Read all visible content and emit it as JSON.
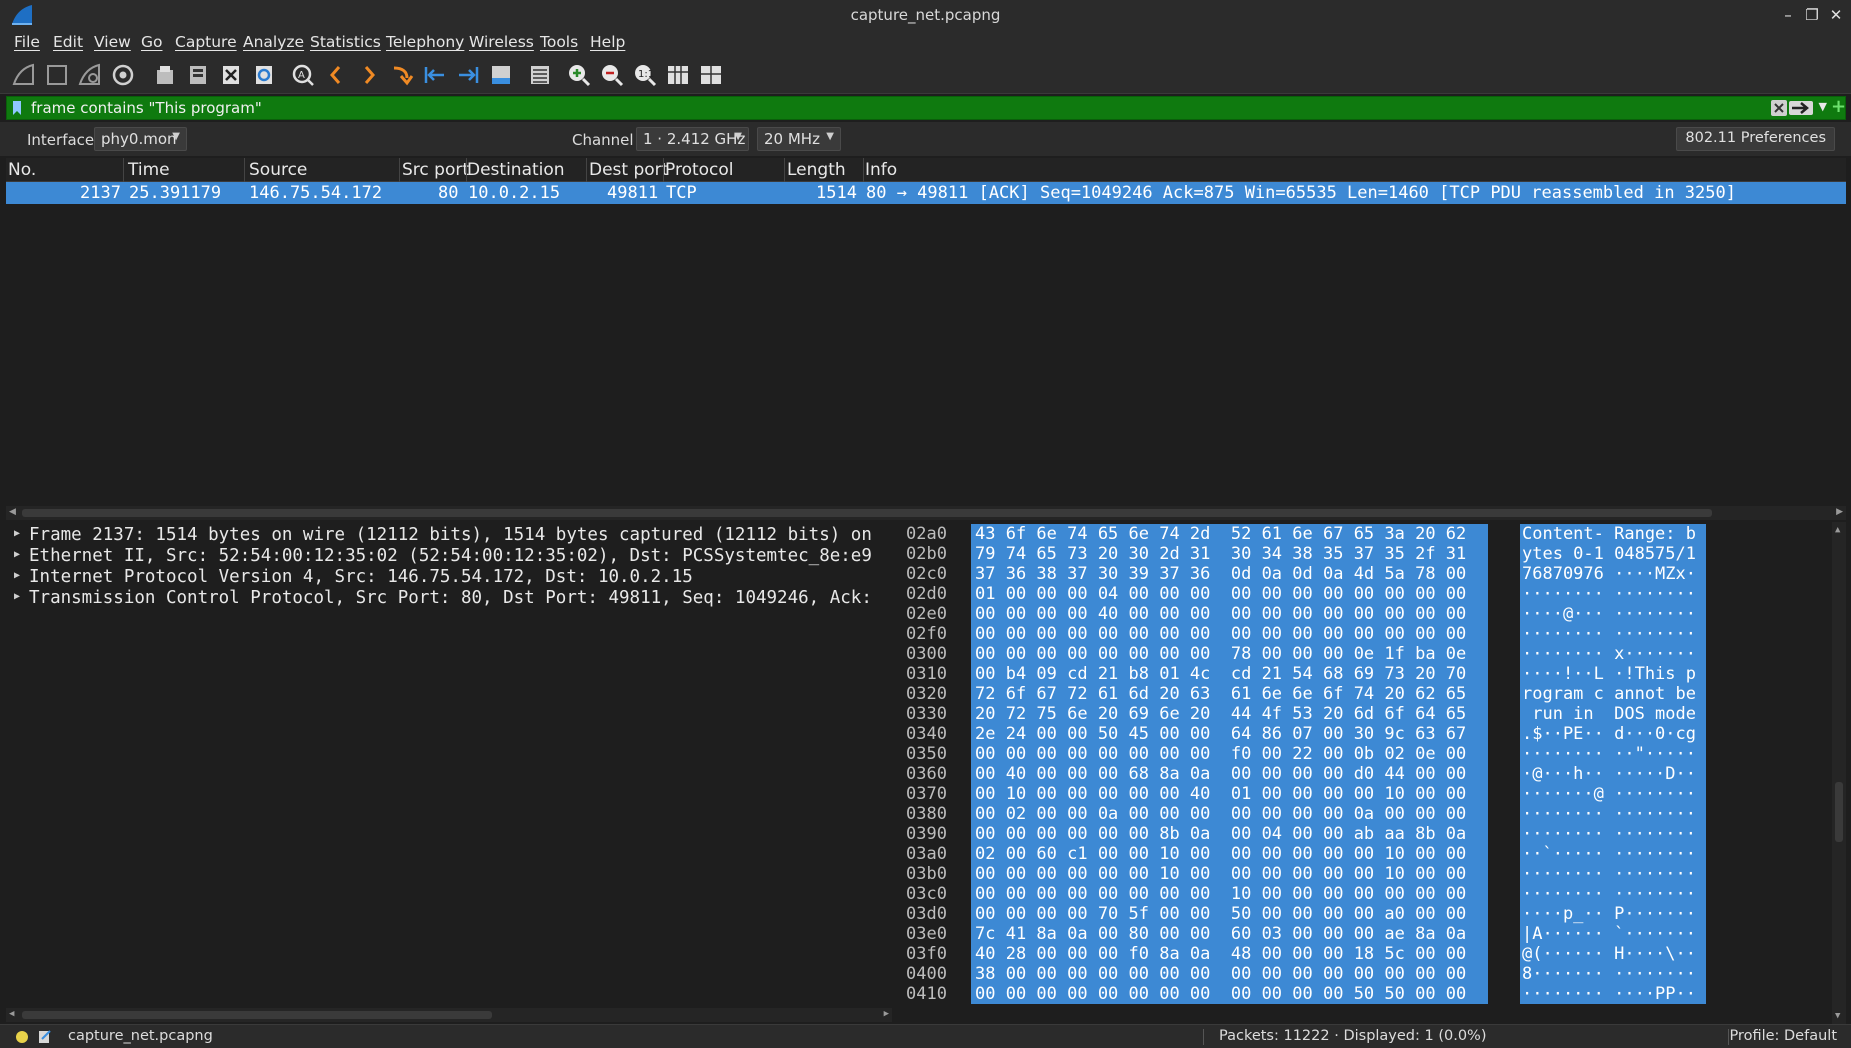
{
  "window": {
    "title": "capture_net.pcapng"
  },
  "menu": [
    "File",
    "Edit",
    "View",
    "Go",
    "Capture",
    "Analyze",
    "Statistics",
    "Telephony",
    "Wireless",
    "Tools",
    "Help"
  ],
  "toolbar_icons": [
    "shark-fin-start-icon",
    "stop-icon",
    "restart-icon",
    "capture-options-icon",
    "open-file-icon",
    "save-file-icon",
    "close-file-icon",
    "reload-icon",
    "find-packet-icon",
    "go-back-icon",
    "go-forward-icon",
    "go-to-packet-icon",
    "first-packet-icon",
    "last-packet-icon",
    "autoscroll-icon",
    "colorize-icon",
    "zoom-in-icon",
    "zoom-out-icon",
    "zoom-reset-icon",
    "resize-columns-icon",
    "layout-icon"
  ],
  "filter": {
    "text": "frame contains \"This program\"",
    "bg_color": "#0f7a0f"
  },
  "wireless": {
    "interface_label": "Interface",
    "interface_value": "phy0.mon",
    "channel_label": "Channel",
    "channel_value": "1 · 2.412 GHz",
    "width_value": "20 MHz",
    "prefs_label": "802.11 Preferences"
  },
  "packet_list": {
    "columns": [
      "No.",
      "Time",
      "Source",
      "Src port",
      "Destination",
      "Dest port",
      "Protocol",
      "Length",
      "Info"
    ],
    "rows": [
      {
        "no": "2137",
        "time": "25.391179",
        "source": "146.75.54.172",
        "src_port": "80",
        "destination": "10.0.2.15",
        "dest_port": "49811",
        "protocol": "TCP",
        "length": "1514",
        "info": "80 → 49811 [ACK] Seq=1049246 Ack=875 Win=65535 Len=1460 [TCP PDU reassembled in 3250]"
      }
    ],
    "selected_color": "#3d89d4"
  },
  "details": [
    "Frame 2137: 1514 bytes on wire (12112 bits), 1514 bytes captured (12112 bits) on",
    "Ethernet II, Src: 52:54:00:12:35:02 (52:54:00:12:35:02), Dst: PCSSystemtec_8e:e9",
    "Internet Protocol Version 4, Src: 146.75.54.172, Dst: 10.0.2.15",
    "Transmission Control Protocol, Src Port: 80, Dst Port: 49811, Seq: 1049246, Ack:"
  ],
  "bytes": {
    "offsets": [
      "02a0",
      "02b0",
      "02c0",
      "02d0",
      "02e0",
      "02f0",
      "0300",
      "0310",
      "0320",
      "0330",
      "0340",
      "0350",
      "0360",
      "0370",
      "0380",
      "0390",
      "03a0",
      "03b0",
      "03c0",
      "03d0",
      "03e0",
      "03f0",
      "0400",
      "0410"
    ],
    "hex": [
      "43 6f 6e 74 65 6e 74 2d  52 61 6e 67 65 3a 20 62",
      "79 74 65 73 20 30 2d 31  30 34 38 35 37 35 2f 31",
      "37 36 38 37 30 39 37 36  0d 0a 0d 0a 4d 5a 78 00",
      "01 00 00 00 04 00 00 00  00 00 00 00 00 00 00 00",
      "00 00 00 00 40 00 00 00  00 00 00 00 00 00 00 00",
      "00 00 00 00 00 00 00 00  00 00 00 00 00 00 00 00",
      "00 00 00 00 00 00 00 00  78 00 00 00 0e 1f ba 0e",
      "00 b4 09 cd 21 b8 01 4c  cd 21 54 68 69 73 20 70",
      "72 6f 67 72 61 6d 20 63  61 6e 6e 6f 74 20 62 65",
      "20 72 75 6e 20 69 6e 20  44 4f 53 20 6d 6f 64 65",
      "2e 24 00 00 50 45 00 00  64 86 07 00 30 9c 63 67",
      "00 00 00 00 00 00 00 00  f0 00 22 00 0b 02 0e 00",
      "00 40 00 00 00 68 8a 0a  00 00 00 00 d0 44 00 00",
      "00 10 00 00 00 00 00 40  01 00 00 00 00 10 00 00",
      "00 02 00 00 0a 00 00 00  00 00 00 00 0a 00 00 00",
      "00 00 00 00 00 00 8b 0a  00 04 00 00 ab aa 8b 0a",
      "02 00 60 c1 00 00 10 00  00 00 00 00 00 10 00 00",
      "00 00 00 00 00 00 10 00  00 00 00 00 00 10 00 00",
      "00 00 00 00 00 00 00 00  10 00 00 00 00 00 00 00",
      "00 00 00 00 70 5f 00 00  50 00 00 00 00 a0 00 00",
      "7c 41 8a 0a 00 80 00 00  60 03 00 00 00 ae 8a 0a",
      "40 28 00 00 00 f0 8a 0a  48 00 00 00 18 5c 00 00",
      "38 00 00 00 00 00 00 00  00 00 00 00 00 00 00 00",
      "00 00 00 00 00 00 00 00  00 00 00 00 50 50 00 00"
    ],
    "ascii": [
      "Content- Range: b",
      "ytes 0-1 048575/1",
      "76870976 ····MZx·",
      "········ ········",
      "····@··· ········",
      "········ ········",
      "········ x·······",
      "····!··L ·!This p",
      "rogram c annot be",
      " run in  DOS mode",
      ".$··PE·· d···0·cg",
      "········ ··\"·····",
      "·@···h·· ·····D··",
      "·······@ ········",
      "········ ········",
      "········ ········",
      "··`····· ········",
      "········ ········",
      "········ ········",
      "····p_·· P·······",
      "|A······ `·······",
      "@(······ H····\\··",
      "8······· ········",
      "········ ····PP··"
    ]
  },
  "status": {
    "file": "capture_net.pcapng",
    "packets": "Packets: 11222 · Displayed: 1 (0.0%)",
    "profile": "Profile: Default",
    "indicator_color": "#e8d24a"
  }
}
